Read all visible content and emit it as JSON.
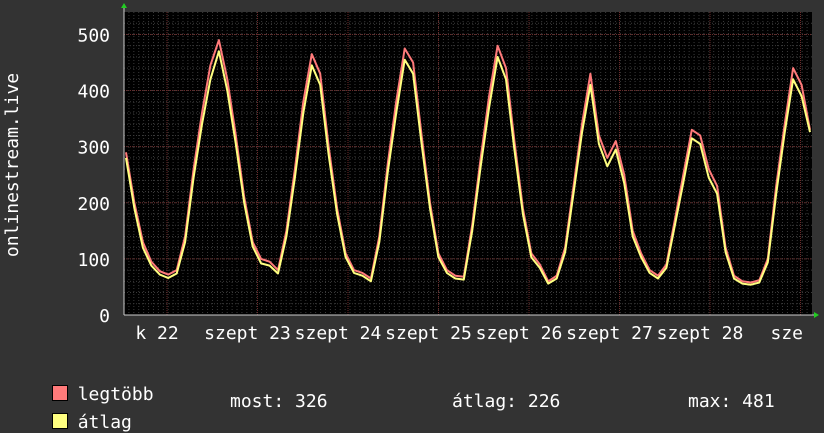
{
  "chart_data": {
    "type": "line",
    "ylabel": "onlinestream.live",
    "ylim": [
      0,
      540
    ],
    "y_ticks": [
      "0",
      "100",
      "200",
      "300",
      "400",
      "500"
    ],
    "x_tick_labels": [
      "k 22",
      "szept 23",
      "szept 24",
      "szept 25",
      "szept 26",
      "szept 27",
      "szept 28",
      "sze"
    ],
    "grid": true,
    "series": [
      {
        "name": "legtöbb",
        "color": "#ff7a7a",
        "values": [
          290,
          200,
          130,
          95,
          78,
          72,
          80,
          140,
          260,
          360,
          445,
          490,
          420,
          320,
          210,
          130,
          100,
          95,
          80,
          150,
          260,
          380,
          465,
          430,
          300,
          190,
          110,
          80,
          75,
          65,
          140,
          270,
          380,
          475,
          450,
          320,
          200,
          110,
          80,
          70,
          68,
          160,
          280,
          390,
          480,
          440,
          310,
          190,
          110,
          90,
          60,
          70,
          120,
          230,
          340,
          430,
          320,
          280,
          310,
          250,
          150,
          110,
          80,
          70,
          90,
          170,
          250,
          330,
          320,
          260,
          230,
          120,
          70,
          60,
          58,
          62,
          100,
          230,
          340,
          440,
          410,
          330
        ]
      },
      {
        "name": "átlag",
        "color": "#ffff80",
        "values": [
          280,
          190,
          120,
          88,
          72,
          66,
          74,
          130,
          245,
          340,
          420,
          470,
          400,
          305,
          200,
          122,
          92,
          88,
          74,
          140,
          245,
          360,
          445,
          410,
          285,
          180,
          103,
          75,
          70,
          60,
          130,
          255,
          360,
          455,
          430,
          305,
          190,
          103,
          75,
          65,
          63,
          150,
          265,
          370,
          460,
          420,
          295,
          180,
          103,
          84,
          56,
          65,
          112,
          218,
          325,
          410,
          305,
          265,
          295,
          235,
          140,
          103,
          75,
          65,
          84,
          160,
          236,
          315,
          305,
          245,
          216,
          112,
          65,
          56,
          54,
          58,
          94,
          216,
          325,
          420,
          390,
          326
        ]
      }
    ]
  },
  "legend": [
    {
      "label": "legtöbb",
      "color": "#ff7a7a"
    },
    {
      "label": "átlag",
      "color": "#ffff80"
    }
  ],
  "stats": {
    "most": "most: 326",
    "atlag": "átlag: 226",
    "max": "max: 481"
  }
}
